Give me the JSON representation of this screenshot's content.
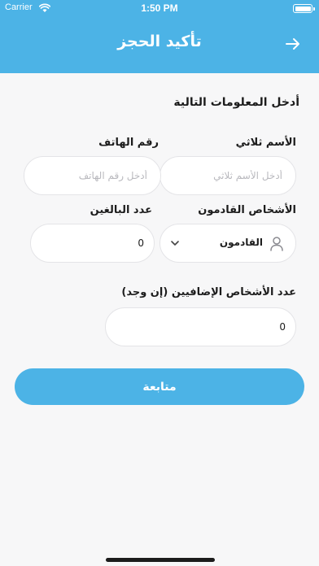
{
  "status_bar": {
    "carrier": "Carrier",
    "time": "1:50 PM"
  },
  "header": {
    "title": "تأكيد الحجز",
    "back_icon": "arrow-right-icon"
  },
  "form": {
    "heading": "أدخل المعلومات التالية",
    "name": {
      "label": "الأسم ثلاثي",
      "placeholder": "أدخل الأسم ثلاثي",
      "value": ""
    },
    "phone": {
      "label": "رقم الهاتف",
      "placeholder": "أدخل رقم الهاتف",
      "value": ""
    },
    "people": {
      "label": "الأشخاص القادمون",
      "selected": "القادمون",
      "icon": "person-icon"
    },
    "adults": {
      "label": "عدد البالغين",
      "value": "0"
    },
    "extra": {
      "label": "عدد الأشخاص الإضافيين (إن وجد)",
      "value": "0"
    },
    "continue_label": "متابعة"
  },
  "colors": {
    "accent": "#4cb3e6",
    "background": "#f7f7f8",
    "field_border": "#e4e4e7"
  }
}
